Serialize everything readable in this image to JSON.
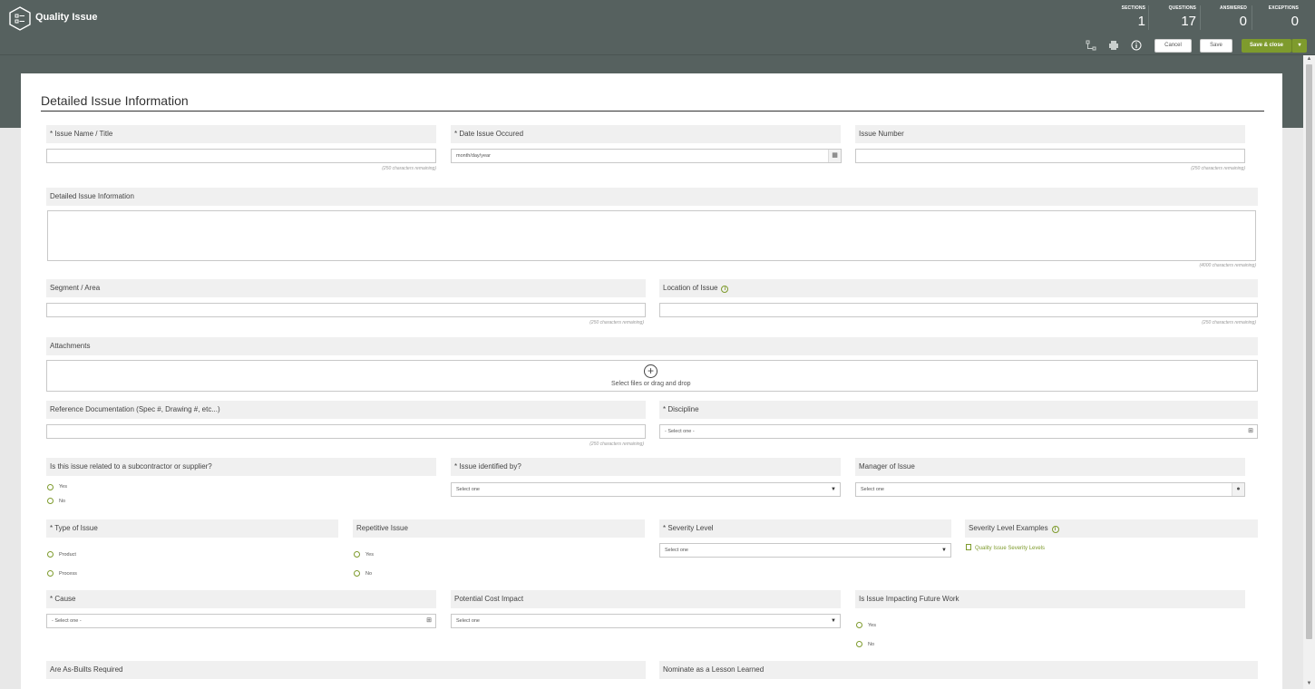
{
  "app": {
    "title": "Quality Issue"
  },
  "stats": [
    {
      "label": "SECTIONS",
      "value": "1"
    },
    {
      "label": "QUESTIONS",
      "value": "17"
    },
    {
      "label": "ANSWERED",
      "value": "0"
    },
    {
      "label": "EXCEPTIONS",
      "value": "0"
    }
  ],
  "toolbar": {
    "icons": [
      "relationship-icon",
      "print-icon",
      "info-icon"
    ],
    "cancel": "Cancel",
    "save": "Save",
    "save_close": "Save & close",
    "dropdown_caret": "▾"
  },
  "section": {
    "title": "Detailed Issue Information"
  },
  "fields": {
    "issue_name": {
      "label": "* Issue Name / Title",
      "value": "",
      "hint": "(250 characters remaining)"
    },
    "date_occurred": {
      "label": "* Date Issue Occured",
      "placeholder": "month/day/year"
    },
    "issue_number": {
      "label": "Issue Number",
      "value": "",
      "hint": "(250 characters remaining)"
    },
    "detailed_info": {
      "label": "Detailed Issue Information",
      "hint": "(4000 characters remaining)"
    },
    "segment_area": {
      "label": "Segment / Area",
      "value": "",
      "hint": "(250 characters remaining)"
    },
    "location": {
      "label": "Location of Issue",
      "value": "",
      "hint": "(250 characters remaining)"
    },
    "attachments": {
      "label": "Attachments",
      "drop_text": "Select files or drag and drop"
    },
    "reference_docs": {
      "label": "Reference Documentation (Spec #, Drawing #, etc...)",
      "value": "",
      "hint": "(250 characters remaining)"
    },
    "discipline": {
      "label": "* Discipline",
      "value": "- Select one -"
    },
    "subcontractor": {
      "label": "Is this issue related to a subcontractor or supplier?",
      "options": [
        "Yes",
        "No"
      ]
    },
    "identified_by": {
      "label": "* Issue identified by?",
      "value": "Select one"
    },
    "manager": {
      "label": "Manager of Issue",
      "value": "Select one"
    },
    "type_of_issue": {
      "label": "* Type of Issue",
      "options": [
        "Product",
        "Process"
      ]
    },
    "repetitive": {
      "label": "Repetitive Issue",
      "options": [
        "Yes",
        "No"
      ]
    },
    "severity": {
      "label": "* Severity Level",
      "value": "Select one"
    },
    "severity_examples": {
      "label": "Severity Level Examples",
      "link": "Quality Issue Severity Levels"
    },
    "cause": {
      "label": "* Cause",
      "value": "- Select one -"
    },
    "cost_impact": {
      "label": "Potential Cost Impact",
      "value": "Select one"
    },
    "future_work": {
      "label": "Is Issue Impacting Future Work",
      "options": [
        "Yes",
        "No"
      ]
    },
    "as_builts": {
      "label": "Are As-Builts Required"
    },
    "lesson_learned": {
      "label": "Nominate as a Lesson Learned"
    }
  }
}
